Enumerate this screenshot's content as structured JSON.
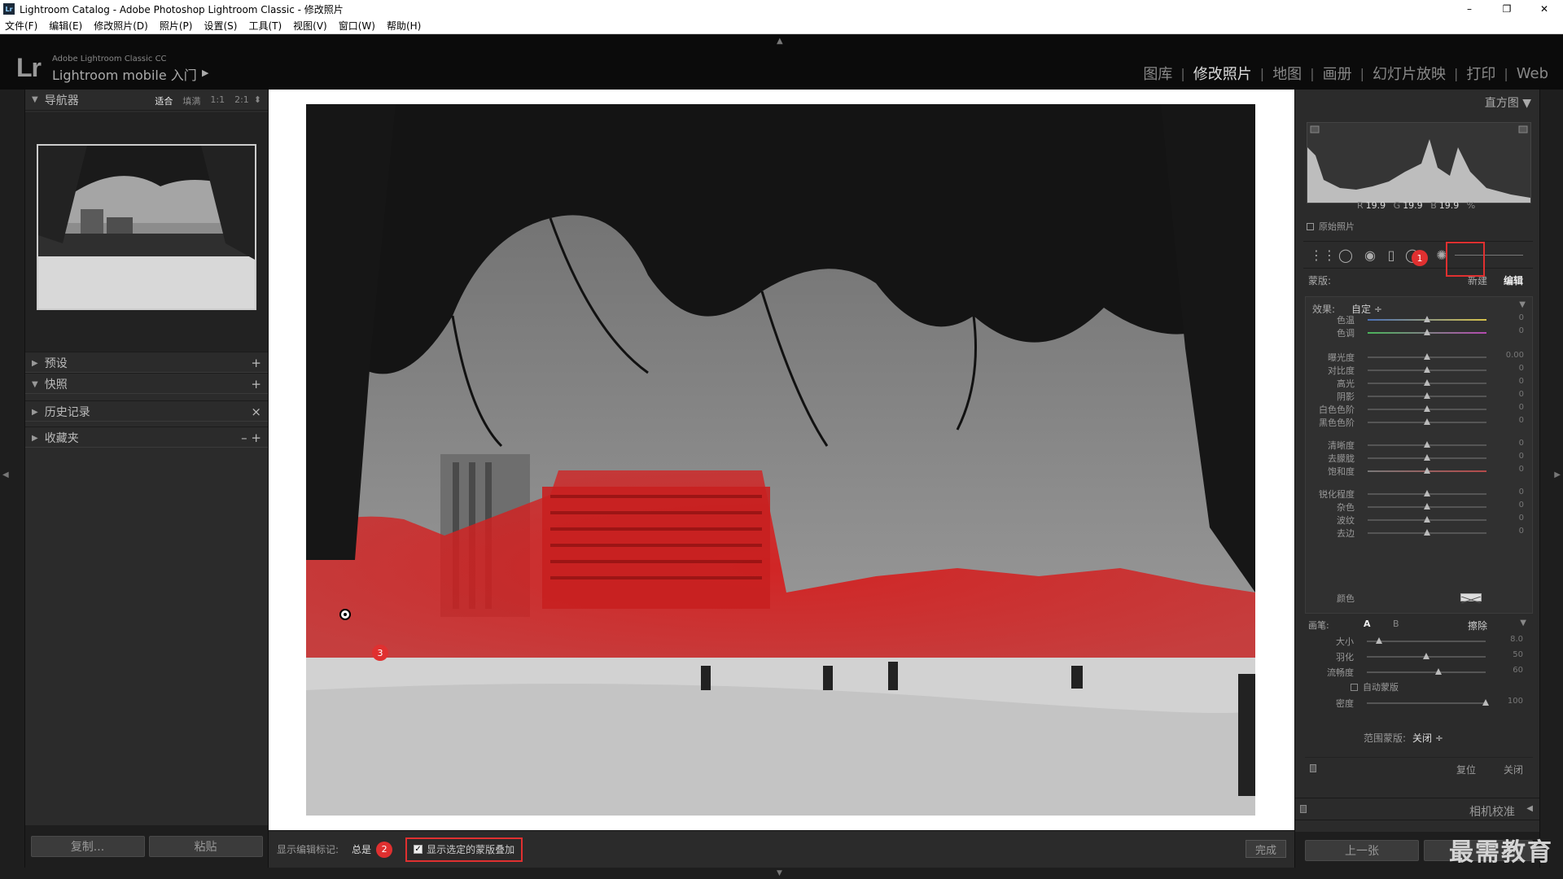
{
  "window": {
    "title": "Lightroom Catalog - Adobe Photoshop Lightroom Classic - 修改照片",
    "app_icon": "Lr",
    "controls": [
      "–",
      "❐",
      "✕"
    ]
  },
  "menu": [
    "文件(F)",
    "编辑(E)",
    "修改照片(D)",
    "照片(P)",
    "设置(S)",
    "工具(T)",
    "视图(V)",
    "窗口(W)",
    "帮助(H)"
  ],
  "identity": {
    "logo": "Lr",
    "small": "Adobe Lightroom Classic CC",
    "main": "Lightroom mobile 入门",
    "arrow": "▶"
  },
  "modules": [
    {
      "label": "图库",
      "active": false
    },
    {
      "label": "修改照片",
      "active": true
    },
    {
      "label": "地图",
      "active": false
    },
    {
      "label": "画册",
      "active": false
    },
    {
      "label": "幻灯片放映",
      "active": false
    },
    {
      "label": "打印",
      "active": false
    },
    {
      "label": "Web",
      "active": false
    }
  ],
  "left_panel": {
    "navigator": {
      "title": "导航器",
      "zoom": [
        "适合",
        "填满",
        "1:1",
        "2:1"
      ],
      "selected_zoom": "适合"
    },
    "sections": [
      {
        "title": "预设",
        "action": "+"
      },
      {
        "title": "快照",
        "action": "+"
      },
      {
        "title": "历史记录",
        "action": "×"
      },
      {
        "title": "收藏夹",
        "action": "– +"
      }
    ],
    "buttons": {
      "copy": "复制...",
      "paste": "粘贴"
    }
  },
  "toolbar": {
    "show_edit_pins_label": "显示编辑标记:",
    "show_edit_pins_value": "总是",
    "overlay_label": "显示选定的蒙版叠加",
    "overlay_checked": true,
    "done": "完成"
  },
  "badges": {
    "b1": "1",
    "b2": "2",
    "b3": "3"
  },
  "right_panel": {
    "histogram_title": "直方图",
    "rgb": {
      "r_label": "R",
      "r": "19.9",
      "g_label": "G",
      "g": "19.9",
      "b_label": "B",
      "b": "19.9",
      "unit": "%"
    },
    "original_photo": "原始照片",
    "mask": {
      "label": "蒙版:",
      "new": "新建",
      "edit": "编辑"
    },
    "effect": {
      "label": "效果:",
      "value": "自定 ÷"
    },
    "sliders": [
      {
        "label": "色温",
        "value": "0",
        "pos": 0.5
      },
      {
        "label": "色调",
        "value": "0",
        "pos": 0.5
      },
      {
        "label": "曝光度",
        "value": "0.00",
        "pos": 0.5
      },
      {
        "label": "对比度",
        "value": "0",
        "pos": 0.5
      },
      {
        "label": "高光",
        "value": "0",
        "pos": 0.5
      },
      {
        "label": "阴影",
        "value": "0",
        "pos": 0.5
      },
      {
        "label": "白色色阶",
        "value": "0",
        "pos": 0.5
      },
      {
        "label": "黑色色阶",
        "value": "0",
        "pos": 0.5
      },
      {
        "label": "清晰度",
        "value": "0",
        "pos": 0.5
      },
      {
        "label": "去朦胧",
        "value": "0",
        "pos": 0.5
      },
      {
        "label": "饱和度",
        "value": "0",
        "pos": 0.5
      },
      {
        "label": "锐化程度",
        "value": "0",
        "pos": 0.5
      },
      {
        "label": "杂色",
        "value": "0",
        "pos": 0.5
      },
      {
        "label": "波纹",
        "value": "0",
        "pos": 0.5
      },
      {
        "label": "去边",
        "value": "0",
        "pos": 0.5
      }
    ],
    "color_label": "颜色",
    "brush": {
      "label": "画笔:",
      "a": "A",
      "b": "B",
      "erase": "擦除",
      "size_label": "大小",
      "size": "8.0",
      "size_pos": 0.1,
      "feather_label": "羽化",
      "feather": "50",
      "feather_pos": 0.5,
      "flow_label": "流畅度",
      "flow": "60",
      "flow_pos": 0.6,
      "auto_mask": "自动蒙版",
      "density_label": "密度",
      "density": "100",
      "density_pos": 1.0
    },
    "range_mask": {
      "label": "范围蒙版:",
      "value": "关闭 ÷"
    },
    "reset": "复位",
    "close": "关闭",
    "camera_calibration": "相机校准",
    "prev": "上一张"
  },
  "watermark": "最需教育"
}
